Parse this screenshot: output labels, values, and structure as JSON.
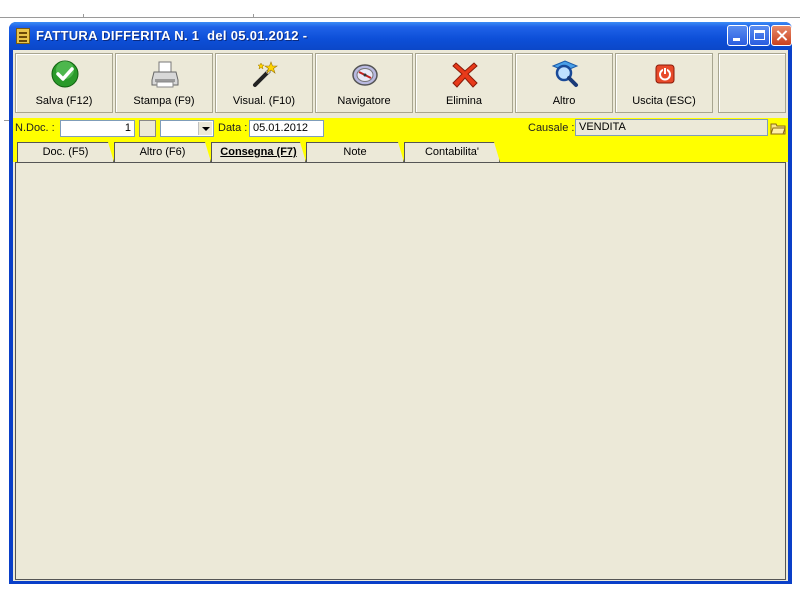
{
  "window": {
    "title": "FATTURA DIFFERITA N. 1  del 05.01.2012 -"
  },
  "toolbar": {
    "buttons": [
      {
        "label": "Salva (F12)",
        "icon": "check-icon"
      },
      {
        "label": "Stampa (F9)",
        "icon": "printer-icon"
      },
      {
        "label": "Visual. (F10)",
        "icon": "magic-wand-icon"
      },
      {
        "label": "Navigatore",
        "icon": "compass-icon"
      },
      {
        "label": "Elimina",
        "icon": "delete-x-icon"
      },
      {
        "label": "Altro",
        "icon": "search-icon"
      },
      {
        "label": "Uscita (ESC)",
        "icon": "power-icon"
      }
    ]
  },
  "header": {
    "ndoc_label": "N.Doc. :",
    "ndoc_value": "1",
    "data_label": "Data :",
    "data_value": "05.01.2012",
    "causale_label": "Causale :",
    "causale_value": "VENDITA"
  },
  "tabs": [
    {
      "label": "Doc. (F5)",
      "active": false
    },
    {
      "label": "Altro (F6)",
      "active": false
    },
    {
      "label": "Consegna (F7)",
      "active": true
    },
    {
      "label": "Note",
      "active": false
    },
    {
      "label": "Contabilita'",
      "active": false
    }
  ],
  "colors": {
    "header_bar": "#ffff00",
    "titlebar": "#0b47c8",
    "panel": "#ece9d8"
  }
}
